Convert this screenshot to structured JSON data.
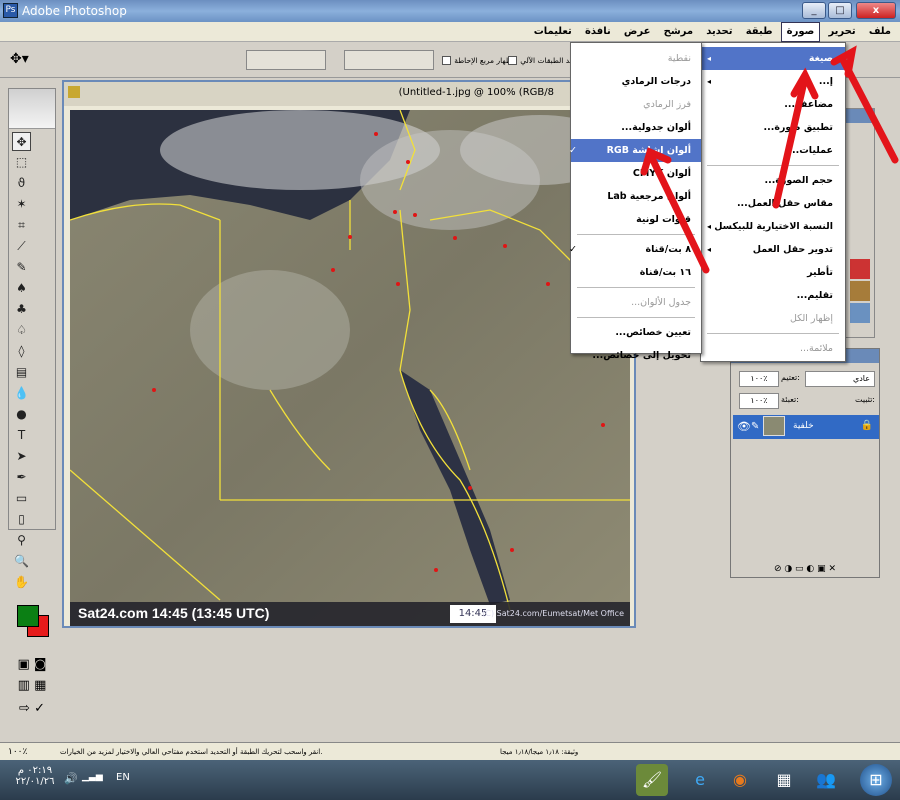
{
  "window": {
    "title": "Adobe Photoshop",
    "min": "_",
    "max": "□",
    "close": "x"
  },
  "menubar": [
    "ملف",
    "تحرير",
    "صورة",
    "طبقة",
    "تحديد",
    "مرشح",
    "عرض",
    "نافذة",
    "تعليمات"
  ],
  "options": {
    "show_bounds": "إظهار مربع الإحاطة",
    "auto_select": "تحديد الطبقات الآلي"
  },
  "document": {
    "title": "(Untitled-1.jpg @ 100% (RGB/8"
  },
  "map": {
    "caption": "Sat24.com 14:45 (13:45 UTC)",
    "time": "14:45",
    "credit": "(C) Sat24.com/Eumetsat/Met Office"
  },
  "image_menu": {
    "items": [
      {
        "label": "صيغة",
        "highlight": true,
        "arrow": true
      },
      {
        "label": "إ...",
        "arrow": true
      },
      {
        "label": "مضاعفة..."
      },
      {
        "label": "تطبيق صورة..."
      },
      {
        "label": "عمليات..."
      },
      {
        "sep": true
      },
      {
        "label": "حجم الصورة..."
      },
      {
        "label": "مقاس حقل العمل..."
      },
      {
        "label": "النسبة الاختيارية للبيكسل",
        "arrow": true
      },
      {
        "label": "تدوير حقل العمل",
        "arrow": true
      },
      {
        "label": "تأطير"
      },
      {
        "label": "تقليم..."
      },
      {
        "label": "إظهار الكل",
        "disabled": true
      },
      {
        "sep": true
      },
      {
        "label": "ملائمة...",
        "disabled": true
      }
    ]
  },
  "mode_menu": {
    "items": [
      {
        "label": "نقطية",
        "disabled": true
      },
      {
        "label": "درجات الرمادي"
      },
      {
        "label": "فرز الرمادي",
        "disabled": true
      },
      {
        "label": "ألوان جدولية..."
      },
      {
        "label": "ألوان اشاشة RGB",
        "highlight": true,
        "check": "✓"
      },
      {
        "label": "ألوان CMYK"
      },
      {
        "label": "ألوان مرجعية Lab"
      },
      {
        "label": "قنوات لونية"
      },
      {
        "sep": true
      },
      {
        "label": "٨ بت/قناة",
        "check": "✓"
      },
      {
        "label": "١٦ بت/قناة"
      },
      {
        "sep": true
      },
      {
        "label": "جدول الألوان...",
        "disabled": true
      },
      {
        "sep": true
      },
      {
        "label": "تعيين خصائص..."
      },
      {
        "label": "تحويل إلى خصائص..."
      }
    ]
  },
  "layers": {
    "blend": "عادي",
    "opacity_label": "تعتيم:",
    "opacity": "١٠٠٪",
    "lock_label": "تثبيت:",
    "fill_label": "تعبئة:",
    "fill": "١٠٠٪",
    "layer_name": "خلفية"
  },
  "statusbar": {
    "zoom": "١٠٠٪",
    "doc": "وثيقة: ١٫١٨ ميجا/١٫١٨ ميجا",
    "hint": "انقر واسحب لتحريك الطبقة أو التحديد استخدم مفتاحي العالي والاختيار لمزيد من الخيارات."
  },
  "taskbar": {
    "lang": "EN",
    "time": "٠٢:١٩ م",
    "date": "٢٢/٠١/٢٦"
  },
  "colors": {
    "foreground": "#0b7f14",
    "background": "#e61b1b",
    "highlight": "#5174c8"
  }
}
